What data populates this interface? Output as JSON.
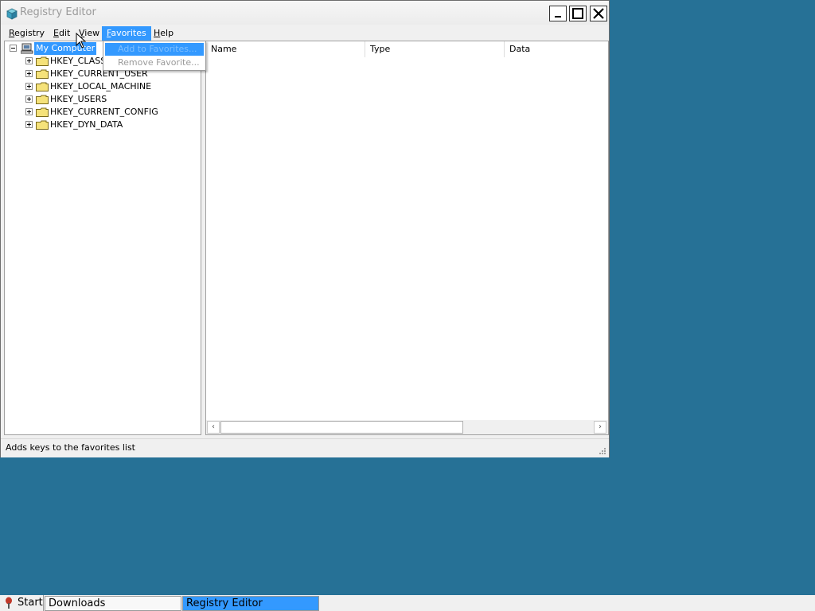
{
  "window": {
    "title": "Registry Editor",
    "controls": {
      "minimize": "minimize",
      "maximize": "maximize",
      "close": "close"
    }
  },
  "menubar": {
    "items": [
      {
        "label": "Registry",
        "mnemonic": "R",
        "rest": "egistry"
      },
      {
        "label": "Edit",
        "mnemonic": "E",
        "rest": "dit"
      },
      {
        "label": "View",
        "mnemonic": "V",
        "rest": "iew"
      },
      {
        "label": "Favorites",
        "mnemonic": "F",
        "rest": "avorites",
        "active": true
      },
      {
        "label": "Help",
        "mnemonic": "H",
        "rest": "elp"
      }
    ]
  },
  "favorites_menu": {
    "items": [
      {
        "label": "Add to Favorites...",
        "highlighted": true,
        "enabled": true
      },
      {
        "label": "Remove Favorite...",
        "highlighted": false,
        "enabled": false
      }
    ]
  },
  "tree": {
    "root": "My Computer",
    "keys": [
      "HKEY_CLASSES_ROOT",
      "HKEY_CURRENT_USER",
      "HKEY_LOCAL_MACHINE",
      "HKEY_USERS",
      "HKEY_CURRENT_CONFIG",
      "HKEY_DYN_DATA"
    ]
  },
  "list": {
    "columns": [
      "Name",
      "Type",
      "Data"
    ]
  },
  "statusbar": {
    "text": "Adds keys to the favorites list"
  },
  "taskbar": {
    "start_label": "Start",
    "tasks": [
      {
        "label": "Downloads",
        "active": false
      },
      {
        "label": "Registry Editor",
        "active": true
      }
    ]
  },
  "colors": {
    "desktop": "#267196",
    "highlight": "#3399ff",
    "folder": "#f5e27a"
  }
}
